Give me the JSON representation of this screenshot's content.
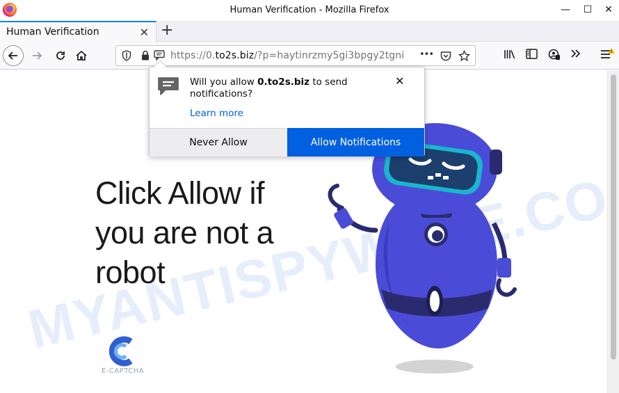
{
  "window": {
    "title": "Human Verification - Mozilla Firefox",
    "minimize": "—",
    "maximize": "☐",
    "close": "✕"
  },
  "tab": {
    "title": "Human Verification",
    "close": "✕",
    "new_tab": "+"
  },
  "urlbar": {
    "prefix": "https://0.",
    "host": "to2s.biz",
    "path": "/?p=haytinrzmy5gi3bpgy2tgni",
    "more": "•••"
  },
  "popup": {
    "message_before": "Will you allow ",
    "domain": "0.to2s.biz",
    "message_after": " to send notifications?",
    "learn_more": "Learn more",
    "close": "✕",
    "never_allow": "Never Allow",
    "allow_notifications": "Allow Notifications"
  },
  "page": {
    "headline": "Click Allow if you are not a robot",
    "captcha_label": "E-CAPTCHA",
    "watermark": "MYANTISPYWARE.COM"
  },
  "colors": {
    "accent": "#0060df",
    "robot_body": "#4a4cd8",
    "robot_dark": "#2a2a6e",
    "visor": "#1b8fa6"
  }
}
